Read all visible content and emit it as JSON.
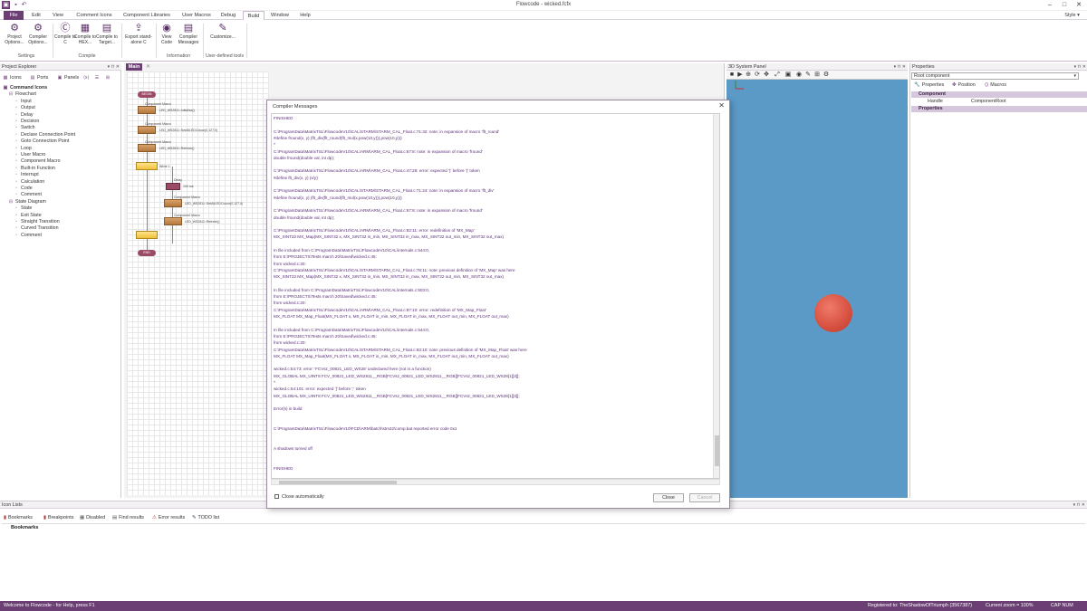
{
  "titlebar": {
    "title": "Flowcode - wicked.fcfx"
  },
  "menus": [
    "File",
    "Edit",
    "View",
    "Comment Icons",
    "Component Libraries",
    "User Macros",
    "Debug",
    "Build",
    "Window",
    "Help"
  ],
  "style_label": "Style",
  "ribbon": {
    "buttons": [
      {
        "label": "Project Options...",
        "icon": "gear-icon"
      },
      {
        "label": "Compiler Options...",
        "icon": "gears-icon"
      },
      {
        "label": "Compile to C",
        "icon": "c-file-icon"
      },
      {
        "label": "Compile to HEX...",
        "icon": "hex-file-icon"
      },
      {
        "label": "Compile to Target...",
        "icon": "target-chip-icon"
      },
      {
        "label": "Export stand-alone C",
        "icon": "export-icon"
      },
      {
        "label": "View Code",
        "icon": "eye-icon"
      },
      {
        "label": "Compiler Messages",
        "icon": "messages-icon"
      },
      {
        "label": "Customize...",
        "icon": "pencil-icon"
      }
    ],
    "groups": [
      "Settings",
      "Compile",
      "Information",
      "User-defined tools"
    ]
  },
  "explorer": {
    "title": "Project Explorer",
    "tabs": [
      "Icons",
      "Ports",
      "Panels"
    ],
    "tree": [
      {
        "label": "Command Icons",
        "level": 0,
        "bold": true
      },
      {
        "label": "Flowchart",
        "level": 1
      },
      {
        "label": "Input",
        "level": 2
      },
      {
        "label": "Output",
        "level": 2
      },
      {
        "label": "Delay",
        "level": 2
      },
      {
        "label": "Decision",
        "level": 2
      },
      {
        "label": "Switch",
        "level": 2
      },
      {
        "label": "Declare Connection Point",
        "level": 2
      },
      {
        "label": "Goto Connection Point",
        "level": 2
      },
      {
        "label": "Loop",
        "level": 2
      },
      {
        "label": "User Macro",
        "level": 2
      },
      {
        "label": "Component Macro",
        "level": 2
      },
      {
        "label": "Built-in Function",
        "level": 2
      },
      {
        "label": "Interrupt",
        "level": 2
      },
      {
        "label": "Calculation",
        "level": 2
      },
      {
        "label": "Code",
        "level": 2
      },
      {
        "label": "Comment",
        "level": 2
      },
      {
        "label": "State Diagram",
        "level": 1
      },
      {
        "label": "State",
        "level": 2
      },
      {
        "label": "Exit State",
        "level": 2
      },
      {
        "label": "Straight Transition",
        "level": 2
      },
      {
        "label": "Curved Transition",
        "level": 2
      },
      {
        "label": "Comment",
        "level": 2
      }
    ]
  },
  "main": {
    "tab": "Main",
    "flowchart": {
      "begin": "BEGIN",
      "end": "END",
      "macro1_title": "Component Macro",
      "macro1_text": "LED_WS2811::Initialise()",
      "macro2_title": "Component Macro",
      "macro2_text": "LED_WS2811::SetAllLEDColour(0,127,0)",
      "macro3_title": "Component Macro",
      "macro3_text": "LED_WS2811::Refresh()",
      "loop_text": "While 1",
      "delay_title": "Delay",
      "delay_text": "100 ms",
      "macro4_title": "Component Macro",
      "macro4_text": "LED_WS2811::SetAllLEDColour(0,127,0)",
      "macro5_title": "Component Macro",
      "macro5_text": "LED_WS2811::Refresh()"
    }
  },
  "system3d": {
    "title": "3D System Panel"
  },
  "properties": {
    "title": "Properties",
    "selected": "Root component",
    "tabs": [
      "Properties",
      "Position",
      "Macros"
    ],
    "sections": [
      "Component",
      "Properties"
    ],
    "rows": [
      {
        "name": "Handle",
        "value": "ComponentRoot"
      }
    ]
  },
  "dialog": {
    "title": "Compiler Messages",
    "lines": [
      "FINISHED",
      "",
      "C:\\ProgramData\\MatrixTSL\\FlowcodeV10\\CAL\\STARM\\STARM_CAL_Float.c:71:32: note: in expansion of macro 'flt_round'",
      " #define fround(x, y)  (flt_div(flt_round(flt_mul(x,pow(10,y))),pow(10,y)))",
      "                       ^",
      "C:\\ProgramData\\MatrixTSL\\FlowcodeV10\\CAL\\ARM\\ARM_CAL_Float.c:67:8: note: in expansion of macro 'fround'",
      " double fround(double val, int dp);",
      "",
      "C:\\ProgramData\\MatrixTSL\\FlowcodeV10\\CAL\\ARM\\ARM_CAL_Float.c:47:28: error: expected ')' before '(' token",
      " #define flt_div(x, y)  (x/y)",
      "",
      "C:\\ProgramData\\MatrixTSL\\FlowcodeV10\\CAL\\STARM\\STARM_CAL_Float.c:71:24: note: in expansion of macro 'flt_div'",
      " #define fround(x, y)  (flt_div(flt_round(flt_mul(x,pow(10,y))),pow(10,y)))",
      "",
      "C:\\ProgramData\\MatrixTSL\\FlowcodeV10\\CAL\\ARM\\ARM_CAL_Float.c:67:8: note: in expansion of macro 'fround'",
      " double fround(double val, int dp);",
      "",
      "C:\\ProgramData\\MatrixTSL\\FlowcodeV10\\CAL\\ARM\\ARM_CAL_Float.c:82:11: error: redefinition of 'MX_Map'",
      " MX_SINT32 MX_Map(MX_SINT32 x, MX_SINT32 in_min, MX_SINT32 in_max, MX_SINT32 out_min, MX_SINT32 out_max)",
      "",
      "In file included from C:\\ProgramData\\MatrixTSL\\FlowcodeV10\\CAL\\internals.c:544:0,",
      "                 from E:\\PROJECTS\\Tests march 20\\Saved\\wicked.c:45:",
      "                 from wicked.c:20:",
      "C:\\ProgramData\\MatrixTSL\\FlowcodeV10\\CAL\\STARM\\STARM_CAL_Float.c:78:11: note: previous definition of 'MX_Map' was here",
      " MX_SINT32 MX_Map(MX_SINT32 x, MX_SINT32 in_min, MX_SINT32 in_max, MX_SINT32 out_min, MX_SINT32 out_max)",
      "",
      "In file included from C:\\ProgramData\\MatrixTSL\\FlowcodeV10\\CAL\\internals.c:503:0,",
      "                 from E:\\PROJECTS\\Tests march 20\\Saved\\wicked.c:45:",
      "                 from wicked.c:20:",
      "C:\\ProgramData\\MatrixTSL\\FlowcodeV10\\CAL\\ARM\\ARM_CAL_Float.c:87:10: error: redefinition of 'MX_Map_Float'",
      " MX_FLOAT MX_Map_Float(MX_FLOAT x, MX_FLOAT in_min, MX_FLOAT in_max, MX_FLOAT out_min, MX_FLOAT out_max)",
      "",
      "In file included from C:\\ProgramData\\MatrixTSL\\FlowcodeV10\\CAL\\internals.c:544:0,",
      "                 from E:\\PROJECTS\\Tests march 20\\Saved\\wicked.c:45:",
      "                 from wicked.c:20:",
      "C:\\ProgramData\\MatrixTSL\\FlowcodeV10\\CAL\\STARM\\STARM_CAL_Float.c:83:10: note: previous definition of 'MX_Map_Float' was here",
      " MX_FLOAT MX_Map_Float(MX_FLOAT x, MX_FLOAT in_min, MX_FLOAT in_max, MX_FLOAT out_min, MX_FLOAT out_max)",
      "",
      "wicked.c:54:73: error: 'FCVsz_00821_LED_WS28' undeclared here (not in a function)",
      " MX_GLOBAL MX_UINT8 FCV_00821_LED_WS2811__RGB[FCVsz_00821_LED_WS2811__RGB][FCVsz_00821_LED_WS28[1][3]];",
      "                                                               ^",
      "wicked.c:54:101: error: expected ']' before ';' token",
      " MX_GLOBAL MX_UINT8 FCV_00821_LED_WS2811__RGB[FCVsz_00821_LED_WS2811__RGB][FCVsz_00821_LED_WS28[1][3]];",
      "",
      "Error(s) in build",
      "",
      "",
      "C:\\ProgramData\\MatrixTSL\\FlowcodeV10\\FCD\\ARM\\batch\\stm32\\comp.bat reported error code 0x1",
      "",
      "",
      "A shadows turned off",
      "",
      "",
      "FINISHED"
    ],
    "close_auto_label": "Close automatically",
    "close_button": "Close",
    "cancel_button": "Cancel"
  },
  "bottom": {
    "title": "Icon Lists",
    "tabs": [
      "Bookmarks",
      "Breakpoints",
      "Disabled",
      "Find results",
      "Error results",
      "TODO list"
    ],
    "active_header": "Bookmarks"
  },
  "status": {
    "left": "Welcome to Flowcode - for Help, press F1",
    "registered": "Registered to: TheShadowOfTriumph (3567387)",
    "zoom": "Current zoom = 100%",
    "keys": "CAP  NUM  SCRL"
  },
  "colors": {
    "accent": "#6b3f74",
    "panel3d": "#5b9ac7",
    "ball": "#d6503f",
    "dialog_text": "#5a2e78"
  }
}
